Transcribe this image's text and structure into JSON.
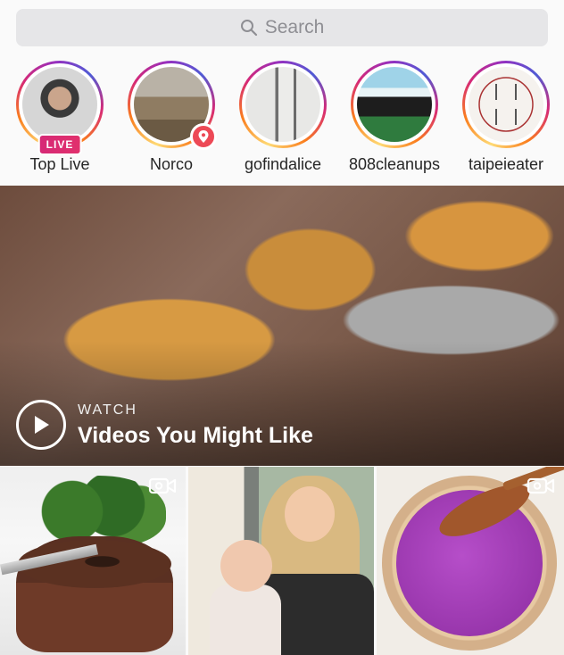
{
  "search": {
    "placeholder": "Search"
  },
  "stories": [
    {
      "label": "Top Live",
      "badge": "LIVE"
    },
    {
      "label": "Norco"
    },
    {
      "label": "gofindalice"
    },
    {
      "label": "808cleanups"
    },
    {
      "label": "taipeieater"
    }
  ],
  "hero": {
    "kicker": "WATCH",
    "title": "Videos You Might Like"
  },
  "colors": {
    "live": "#e1306c",
    "location": "#ed4956"
  },
  "icons": {
    "search": "magnifier",
    "play": "play-circle",
    "video": "video-camera",
    "location": "location-pin"
  }
}
